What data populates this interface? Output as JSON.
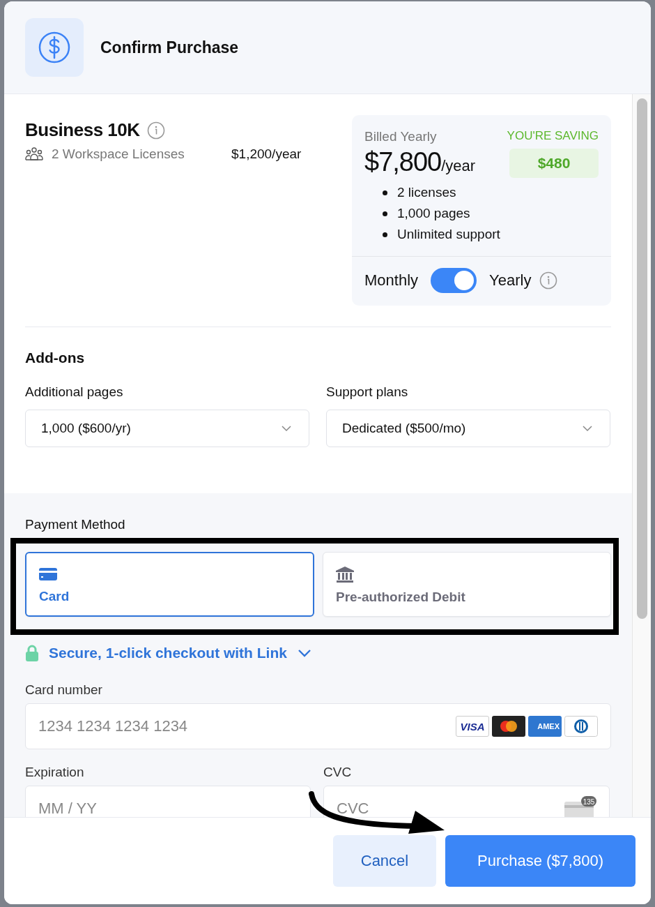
{
  "dialog": {
    "title": "Confirm Purchase"
  },
  "plan": {
    "name": "Business 10K",
    "licenses": "2 Workspace Licenses",
    "price": "$1,200/year"
  },
  "summary": {
    "billing_label": "Billed Yearly",
    "total": "$7,800",
    "period": "/year",
    "saving_label": "YOU'RE SAVING",
    "saving_amount": "$480",
    "features": [
      "2 licenses",
      "1,000 pages",
      "Unlimited support"
    ],
    "toggle": {
      "left_label": "Monthly",
      "right_label": "Yearly",
      "on": true
    }
  },
  "addons": {
    "title": "Add-ons",
    "fields": [
      {
        "label": "Additional pages",
        "value": "1,000 ($600/yr)"
      },
      {
        "label": "Support plans",
        "value": "Dedicated ($500/mo)"
      }
    ]
  },
  "payment": {
    "title": "Payment Method",
    "methods": [
      {
        "label": "Card",
        "kind": "card",
        "selected": true
      },
      {
        "label": "Pre-authorized Debit",
        "kind": "bank",
        "selected": false
      }
    ],
    "link_offer": "Secure, 1-click checkout with Link",
    "card_number": {
      "label": "Card number",
      "placeholder": "1234 1234 1234 1234"
    },
    "card_brands": [
      {
        "kind": "visa",
        "text": "VISA"
      },
      {
        "kind": "mastercard"
      },
      {
        "kind": "amex",
        "text": "AMEX"
      },
      {
        "kind": "diners"
      }
    ],
    "expiration": {
      "label": "Expiration",
      "placeholder": "MM / YY"
    },
    "cvc": {
      "label": "CVC",
      "placeholder": "CVC",
      "icon_text": "135"
    }
  },
  "buttons": [
    {
      "label": "Cancel",
      "kind": "secondary"
    },
    {
      "label": "Purchase ($7,800)",
      "kind": "primary"
    }
  ]
}
